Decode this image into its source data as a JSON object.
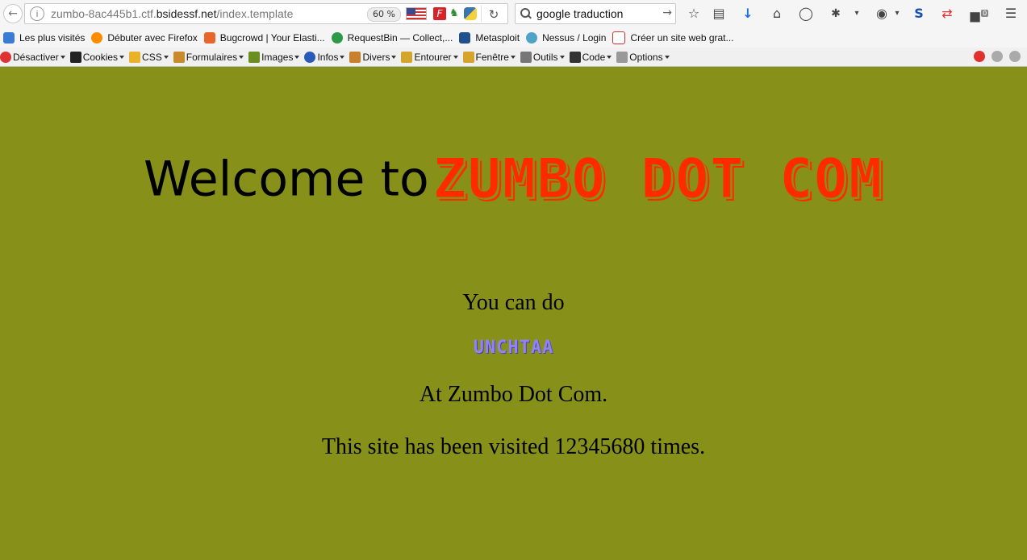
{
  "browser": {
    "url": {
      "prefix": "zumbo-8ac445b1.ctf.",
      "domain": "bsidessf.net",
      "path": "/index.template"
    },
    "zoom": "60 %",
    "search": {
      "value": "google traduction"
    },
    "download_count": "0"
  },
  "bookmarks": [
    "Les plus visités",
    "Débuter avec Firefox",
    "Bugcrowd | Your Elasti...",
    "RequestBin — Collect,...",
    "Metasploit",
    "Nessus / Login",
    "Créer un site web grat..."
  ],
  "devbar": [
    "Désactiver",
    "Cookies",
    "CSS",
    "Formulaires",
    "Images",
    "Infos",
    "Divers",
    "Entourer",
    "Fenêtre",
    "Outils",
    "Code",
    "Options"
  ],
  "page": {
    "welcome": "Welcome to",
    "logo_text": "ZUMBO DOT COM",
    "you_can_do": "You can do",
    "action_logo_text": "UNCHTAA",
    "at_zumbo": "At Zumbo Dot Com.",
    "visited": "This site has been visited 12345680 times."
  },
  "colors": {
    "page_bg": "#879119",
    "logo_red": "#ff2a00",
    "action_purple": "#8f83f5"
  }
}
